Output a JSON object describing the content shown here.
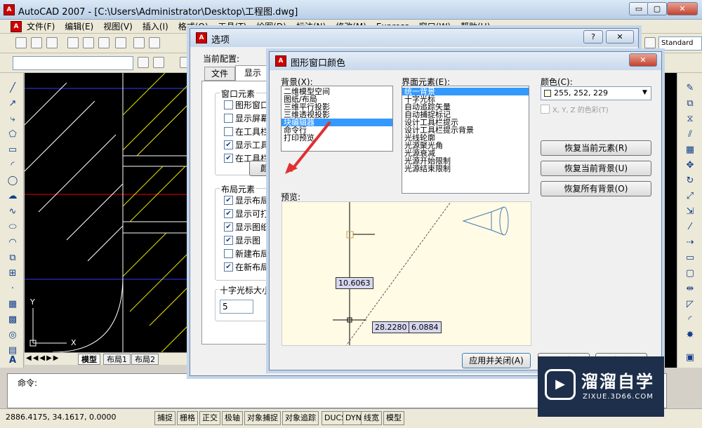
{
  "window": {
    "title": "AutoCAD 2007 - [C:\\Users\\Administrator\\Desktop\\工程图.dwg]",
    "min": "▭",
    "restore": "▢",
    "close": "✕"
  },
  "menu": [
    "文件(F)",
    "编辑(E)",
    "视图(V)",
    "插入(I)",
    "格式(O)",
    "工具(T)",
    "绘图(D)",
    "标注(N)",
    "修改(M)",
    "Express",
    "窗口(W)",
    "帮助(H)"
  ],
  "toolbar": {
    "standard_label": "Standard"
  },
  "layout_tabs": [
    "模型",
    "布局1",
    "布局2"
  ],
  "command": {
    "prompt": "命令:"
  },
  "status": {
    "coords": "2886.4175, 34.1617, 0.0000",
    "buttons": [
      "捕捉",
      "栅格",
      "正交",
      "极轴",
      "对象捕捉",
      "对象追踪",
      "DUCS",
      "DYN",
      "线宽",
      "模型"
    ]
  },
  "options_dialog": {
    "title": "选项",
    "help": "?",
    "close": "✕",
    "current_profile_label": "当前配置:",
    "tabs": [
      "文件",
      "显示"
    ],
    "window_elements": {
      "title": "窗口元素",
      "items": [
        {
          "label": "图形窗口中",
          "checked": false
        },
        {
          "label": "显示屏幕菜",
          "checked": false
        },
        {
          "label": "在工具栏中",
          "checked": false
        },
        {
          "label": "显示工具栏",
          "checked": true
        },
        {
          "label": "在工具栏提",
          "checked": true
        }
      ],
      "color_button": "颜色"
    },
    "layout_elements": {
      "title": "布局元素",
      "items": [
        {
          "label": "显示布局和",
          "checked": true
        },
        {
          "label": "显示可打印",
          "checked": true
        },
        {
          "label": "显示图纸背",
          "checked": true
        },
        {
          "label": "显示图",
          "checked": true
        },
        {
          "label": "新建布局时",
          "checked": false
        },
        {
          "label": "在新布局中",
          "checked": true
        }
      ]
    },
    "crosshair": {
      "title": "十字光标大小",
      "value": "5"
    }
  },
  "color_dialog": {
    "title": "图形窗口颜色",
    "close": "✕",
    "background_label": "背景(X):",
    "background_items": [
      "二维模型空间",
      "图纸/布局",
      "三维平行投影",
      "三维透视投影",
      "块编辑器",
      "命令行",
      "打印预览"
    ],
    "background_selected": 4,
    "interface_label": "界面元素(E):",
    "interface_items": [
      "统一背景",
      "十字光标",
      "自动追踪矢量",
      "自动捕捉标记",
      "设计工具栏提示",
      "设计工具栏提示背景",
      "光线轮廓",
      "光源聚光角",
      "光源衰减",
      "光源开始限制",
      "光源结束限制"
    ],
    "interface_selected": 0,
    "color_label": "颜色(C):",
    "color_value": "255, 252, 229",
    "color_swatch": "#fffce5",
    "xyz_label": "X, Y, Z 的色彩(T)",
    "buttons": [
      "恢复当前元素(R)",
      "恢复当前背景(U)",
      "恢复所有背景(O)"
    ],
    "preview_label": "预览:",
    "measurements": [
      "10.6063",
      "28.2280",
      "6.0884"
    ],
    "apply_button": "应用并关闭(A)",
    "cancel_button": "取消",
    "help_button": "帮助"
  },
  "watermark": {
    "name": "溜溜自学",
    "url": "ZIXUE.3D66.COM"
  }
}
